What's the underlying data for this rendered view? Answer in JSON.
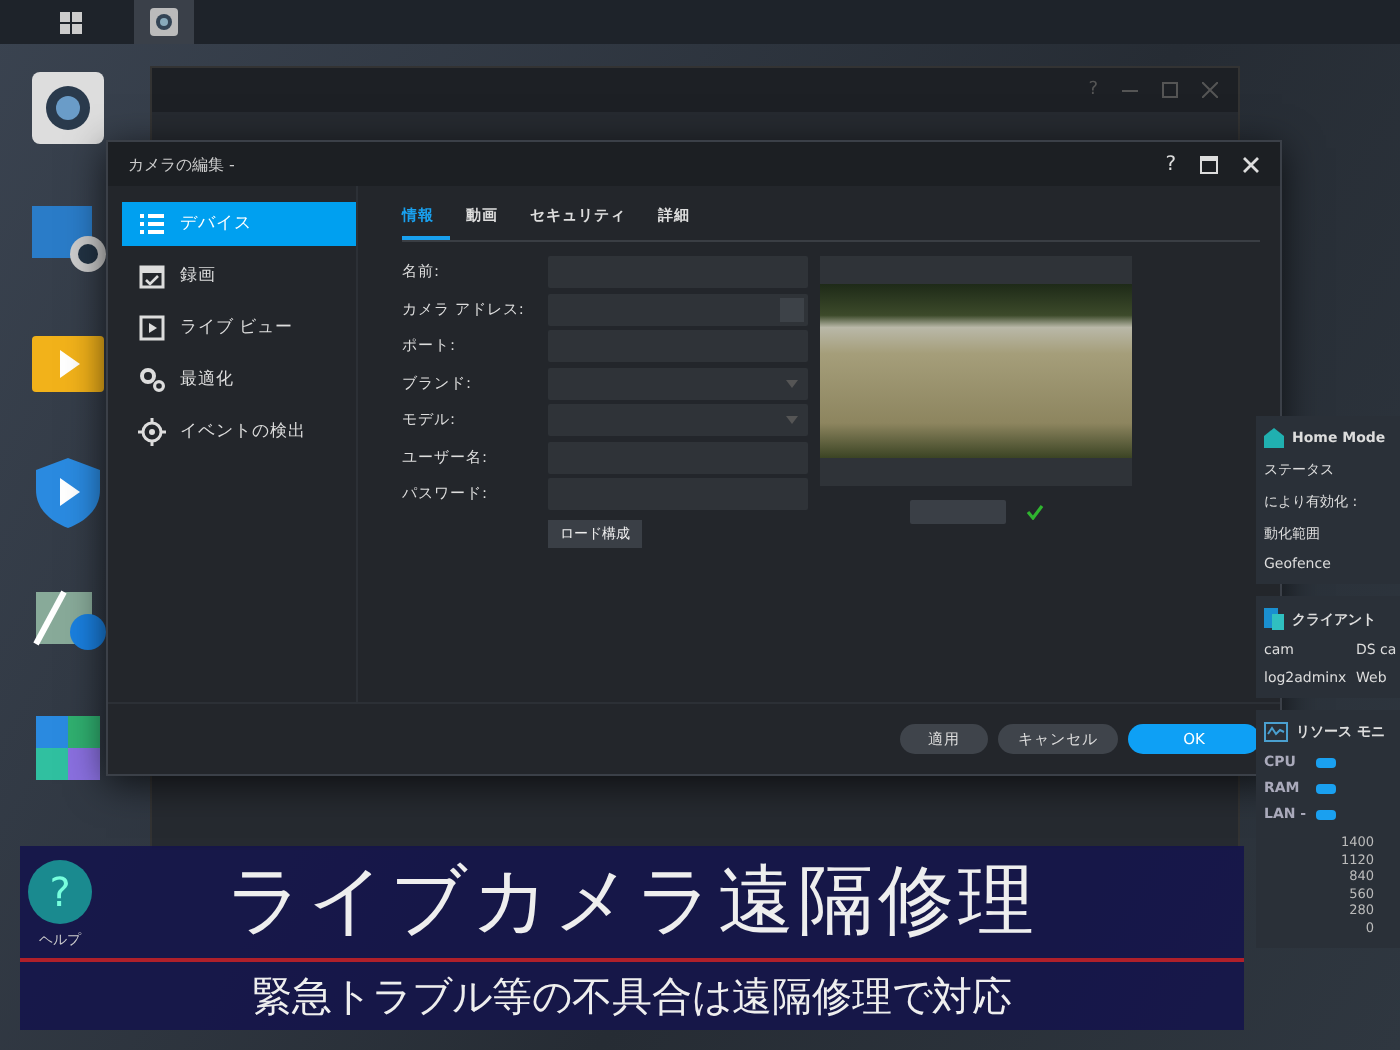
{
  "taskbar": {
    "items": [
      {
        "selected": false
      },
      {
        "selected": true
      }
    ]
  },
  "background_window": {
    "help": "?"
  },
  "help": {
    "glyph": "?",
    "label": "ヘルプ"
  },
  "dialog": {
    "title": "カメラの編集 -",
    "help": "?",
    "sidebar": [
      {
        "label": "デバイス",
        "selected": true
      },
      {
        "label": "録画",
        "selected": false
      },
      {
        "label": "ライブ ビュー",
        "selected": false
      },
      {
        "label": "最適化",
        "selected": false
      },
      {
        "label": "イベントの検出",
        "selected": false
      }
    ],
    "tabs": [
      {
        "label": "情報",
        "selected": true
      },
      {
        "label": "動画",
        "selected": false
      },
      {
        "label": "セキュリティ",
        "selected": false
      },
      {
        "label": "詳細",
        "selected": false
      }
    ],
    "fields": [
      {
        "label": "名前:",
        "kind": "text"
      },
      {
        "label": "カメラ アドレス:",
        "kind": "lookup"
      },
      {
        "label": "ポート:",
        "kind": "text"
      },
      {
        "label": "ブランド:",
        "kind": "select"
      },
      {
        "label": "モデル:",
        "kind": "select"
      },
      {
        "label": "ユーザー名:",
        "kind": "text"
      },
      {
        "label": "パスワード:",
        "kind": "text"
      }
    ],
    "load_button": "ロード構成",
    "buttons": [
      {
        "label": "適用",
        "kind": "secondary"
      },
      {
        "label": "キャンセル",
        "kind": "secondary"
      },
      {
        "label": "OK",
        "kind": "primary"
      }
    ]
  },
  "side_panel": {
    "home_mode": {
      "title": "Home Mode",
      "rows": [
        "ステータス",
        "により有効化 :",
        "動化範囲",
        "Geofence"
      ]
    },
    "clients": {
      "title": "クライアント",
      "rows": [
        [
          "cam",
          "DS ca"
        ],
        [
          "log2adminx",
          "Web"
        ]
      ]
    },
    "resource_monitor": {
      "title": "リソース モニ",
      "rows": [
        "CPU",
        "RAM",
        "LAN -"
      ],
      "axis_labels": [
        "1400",
        "1120",
        "840",
        "560",
        "280",
        "0"
      ]
    }
  },
  "banner": {
    "title": "ライブカメラ遠隔修理",
    "subtitle": "緊急トラブル等の不具合は遠隔修理で対応"
  }
}
